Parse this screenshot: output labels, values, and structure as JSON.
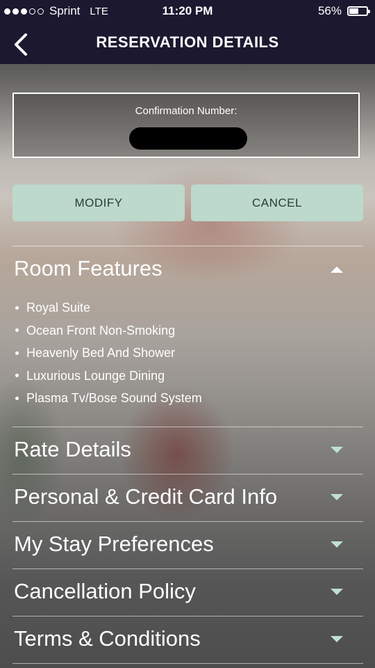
{
  "status_bar": {
    "carrier": "Sprint",
    "network": "LTE",
    "time": "11:20 PM",
    "battery_percent": "56%",
    "battery_level": 0.56,
    "signal_bars": 3,
    "signal_total": 5
  },
  "header": {
    "title": "RESERVATION DETAILS",
    "back_icon": "chevron-left-icon"
  },
  "confirmation": {
    "label": "Confirmation Number:"
  },
  "actions": {
    "modify_label": "MODIFY",
    "cancel_label": "CANCEL",
    "button_color": "#bcd9cc"
  },
  "sections": {
    "room_features": {
      "title": "Room Features",
      "expanded": true,
      "items": [
        "Royal Suite",
        "Ocean Front Non-Smoking",
        "Heavenly Bed And Shower",
        "Luxurious Lounge Dining",
        "Plasma Tv/Bose Sound System"
      ]
    },
    "rate_details": {
      "title": "Rate Details",
      "expanded": false
    },
    "personal_info": {
      "title": "Personal & Credit Card Info",
      "expanded": false
    },
    "stay_preferences": {
      "title": "My Stay Preferences",
      "expanded": false
    },
    "cancellation_policy": {
      "title": "Cancellation Policy",
      "expanded": false
    },
    "terms": {
      "title": "Terms & Conditions",
      "expanded": false
    }
  },
  "colors": {
    "header_bg": "#1c1830",
    "accent": "#bfe0d2"
  }
}
